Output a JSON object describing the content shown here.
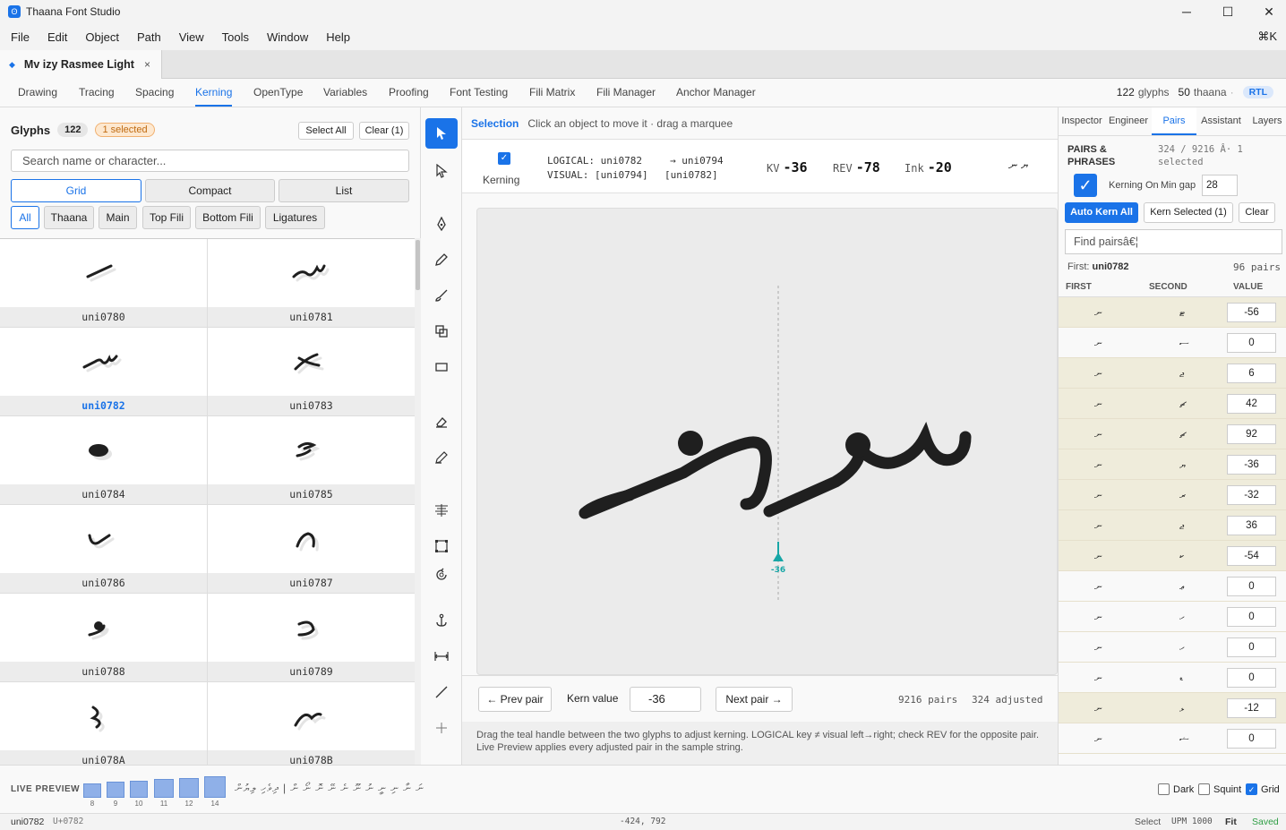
{
  "window": {
    "title": "Thaana Font Studio",
    "minimize": "─",
    "maximize": "☐",
    "close": "✕"
  },
  "menu": [
    "File",
    "Edit",
    "Object",
    "Path",
    "View",
    "Tools",
    "Window",
    "Help"
  ],
  "shortcut": "⌘K",
  "doc_tab": {
    "label": "Mv izy Rasmee Light",
    "close": "×"
  },
  "modes": [
    "Drawing",
    "Tracing",
    "Spacing",
    "Kerning",
    "OpenType",
    "Variables",
    "Proofing",
    "Font Testing",
    "Fili Matrix",
    "Fili Manager",
    "Anchor Manager"
  ],
  "active_mode": "Kerning",
  "stats": {
    "glyphs_n": "122",
    "glyphs_lbl": "glyphs",
    "thaana_n": "50",
    "thaana_lbl": "thaana",
    "sep": "·",
    "rtl": "RTL"
  },
  "glyph_panel": {
    "title": "Glyphs",
    "count": "122",
    "selected": "1 selected",
    "select_all": "Select All",
    "clear": "Clear (1)",
    "search_placeholder": "Search name or character...",
    "views": [
      "Grid",
      "Compact",
      "List"
    ],
    "filters": [
      "All",
      "Thaana",
      "Main",
      "Top Fili",
      "Bottom Fili",
      "Ligatures"
    ],
    "cells": [
      {
        "name": "uni0780",
        "selected": false
      },
      {
        "name": "uni0781",
        "selected": false
      },
      {
        "name": "uni0782",
        "selected": true
      },
      {
        "name": "uni0783",
        "selected": false
      },
      {
        "name": "uni0784",
        "selected": false
      },
      {
        "name": "uni0785",
        "selected": false
      },
      {
        "name": "uni0786",
        "selected": false
      },
      {
        "name": "uni0787",
        "selected": false
      },
      {
        "name": "uni0788",
        "selected": false
      },
      {
        "name": "uni0789",
        "selected": false
      },
      {
        "name": "uni078A",
        "selected": false
      },
      {
        "name": "uni078B",
        "selected": false
      }
    ]
  },
  "selection_bar": {
    "mode": "Selection",
    "hint": "Click an object to move it · drag a marquee"
  },
  "info": {
    "kerning_label": "Kerning",
    "logical": "LOGICAL: uni0782",
    "logical_arrow": "→ uni0794",
    "visual": "VISUAL: [uni0794]",
    "visual2": "[uni0782]",
    "kv_label": "KV",
    "kv": "-36",
    "rev_label": "REV",
    "rev": "-78",
    "ink_label": "Ink",
    "ink": "-20",
    "pair_preview": "ޔ ނ"
  },
  "canvas": {
    "handle_value": "-36"
  },
  "kern_bar": {
    "prev": "← Prev pair",
    "label": "Kern value",
    "value": "-36",
    "next": "Next pair →",
    "pairs": "9216 pairs",
    "adjusted": "324 adjusted"
  },
  "hint": "Drag the teal handle between the two glyphs to adjust kerning. LOGICAL key ≠ visual left→right; check REV for the opposite pair. Live Preview applies every adjusted pair in the sample string.",
  "right_panel": {
    "tabs": [
      "Inspector",
      "Engineer",
      "Pairs",
      "Assistant",
      "Layers"
    ],
    "active_tab": "Pairs",
    "head": "PAIRS & PHRASES",
    "count_line1": "324 / 9216 Â· 1",
    "count_line2": "selected",
    "kerning_on": "Kerning On",
    "min_gap_label": "Min gap",
    "min_gap": "28",
    "auto_kern": "Auto Kern All",
    "kern_selected": "Kern Selected (1)",
    "clear": "Clear",
    "find_placeholder": "Find pairsâ€¦",
    "first_label": "First:",
    "first_value": "uni0782",
    "pairs_count": "96 pairs",
    "columns": [
      "FIRST",
      "SECOND",
      "VALUE"
    ],
    "rows": [
      {
        "first": "ނ",
        "second": "ޓ",
        "value": "-56",
        "adjusted": true
      },
      {
        "first": "ނ",
        "second": "ސ",
        "value": "0",
        "adjusted": false
      },
      {
        "first": "ނ",
        "second": "ޖ",
        "value": "6",
        "adjusted": true
      },
      {
        "first": "ނ",
        "second": "ޗ",
        "value": "42",
        "adjusted": true
      },
      {
        "first": "ނ",
        "second": "ޗ",
        "value": "92",
        "adjusted": true
      },
      {
        "first": "ނ",
        "second": "ޔ",
        "value": "-36",
        "adjusted": true
      },
      {
        "first": "ނ",
        "second": "ރ",
        "value": "-32",
        "adjusted": true
      },
      {
        "first": "ނ",
        "second": "ޖ",
        "value": "36",
        "adjusted": true
      },
      {
        "first": "ނ",
        "second": "ކ",
        "value": "-54",
        "adjusted": true
      },
      {
        "first": "ނ",
        "second": "ޢ",
        "value": "0",
        "adjusted": false
      },
      {
        "first": "ނ",
        "second": "ހ",
        "value": "0",
        "adjusted": false
      },
      {
        "first": "ނ",
        "second": "ހ",
        "value": "0",
        "adjusted": false
      },
      {
        "first": "ނ",
        "second": "ޑ",
        "value": "0",
        "adjusted": false
      },
      {
        "first": "ނ",
        "second": "ޅ",
        "value": "-12",
        "adjusted": true
      },
      {
        "first": "ނ",
        "second": "ޝ",
        "value": "0",
        "adjusted": false
      }
    ]
  },
  "preview": {
    "label": "LIVE PREVIEW",
    "sizes": [
      "8",
      "9",
      "10",
      "11",
      "12",
      "14"
    ],
    "sample": "ނަ ނާ ނި ނީ ނު ނޫ ނެ ނޭ ނޮ ނޯ ން  |  ދިވެހި ލިޔުން",
    "dark": "Dark",
    "squint": "Squint",
    "grid": "Grid"
  },
  "status": {
    "glyph": "uni0782",
    "code": "U+0782",
    "coords": "-424, 792",
    "mode": "Select",
    "upm": "UPM 1000",
    "fit": "Fit",
    "saved": "Saved"
  },
  "colors": {
    "accent": "#1a73e8",
    "teal": "#17a6a6",
    "saved": "#2e9e44",
    "selected_bg": "#fde8d0"
  }
}
